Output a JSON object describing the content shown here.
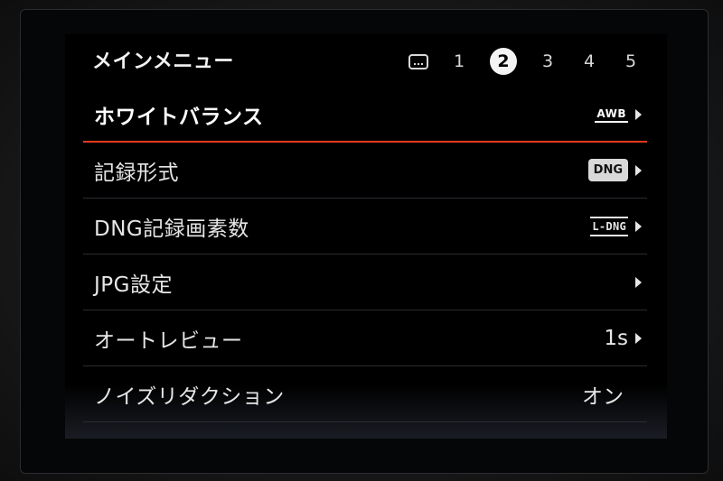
{
  "header": {
    "title": "メインメニュー",
    "pages": [
      "1",
      "2",
      "3",
      "4",
      "5"
    ],
    "active_page": "2",
    "more_icon": "ellipsis-box-icon"
  },
  "menu": {
    "items": [
      {
        "label": "ホワイトバランス",
        "value_icon": "AWB",
        "selected": true
      },
      {
        "label": "記録形式",
        "value_icon": "DNG"
      },
      {
        "label": "DNG記録画素数",
        "value_icon": "L-DNG"
      },
      {
        "label": "JPG設定",
        "value": ""
      },
      {
        "label": "オートレビュー",
        "value": "1s"
      },
      {
        "label": "ノイズリダクション",
        "value": "オン"
      }
    ]
  },
  "colors": {
    "accent": "#e43b1c",
    "screen_bg": "#000000",
    "text": "#e6e6e6"
  }
}
